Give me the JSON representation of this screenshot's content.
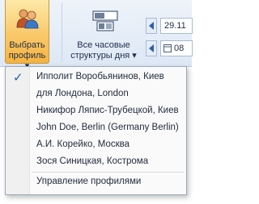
{
  "toolbar": {
    "profile_button": {
      "line1": "Выбрать",
      "line2": "профиль ▾",
      "icon": "users-icon"
    },
    "day_structure_button": {
      "line1": "Все часовые",
      "line2": "структуры дня ▾",
      "icon": "layout-icon"
    },
    "date_from": {
      "value": "29.11"
    },
    "date_to": {
      "value": "08"
    }
  },
  "profile_menu": {
    "items": [
      {
        "label": "Ипполит Воробьянинов, Киев",
        "checked": true
      },
      {
        "label": "для Лондона, London",
        "checked": false
      },
      {
        "label": "Никифор Ляпис-Трубецкой, Киев",
        "checked": false
      },
      {
        "label": "John Doe, Berlin (Germany   Berlin)",
        "checked": false
      },
      {
        "label": "А.И. Корейко, Москва",
        "checked": false
      },
      {
        "label": "Зося Синицкая, Кострома",
        "checked": false
      }
    ],
    "manage_label": "Управление профилями",
    "check_glyph": "✓"
  },
  "colors": {
    "accent": "#f9c96a",
    "ribbon": "#dde8f5",
    "text": "#1e2d4a"
  }
}
